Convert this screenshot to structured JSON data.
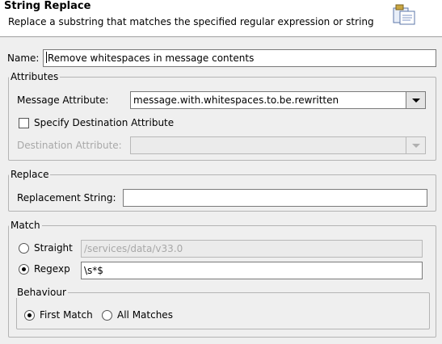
{
  "header": {
    "title": "String Replace",
    "description": "Replace a substring that matches the specified regular expression or string",
    "icon": "dialog-banner-icon"
  },
  "name": {
    "label": "Name:",
    "value": "Remove whitespaces in message contents"
  },
  "attributes": {
    "title": "Attributes",
    "message_attribute_label": "Message Attribute:",
    "message_attribute_value": "message.with.whitespaces.to.be.rewritten",
    "specify_destination_label": "Specify Destination Attribute",
    "destination_attribute_label": "Destination Attribute:",
    "destination_attribute_value": ""
  },
  "replace": {
    "title": "Replace",
    "replacement_label": "Replacement String:",
    "replacement_value": ""
  },
  "match": {
    "title": "Match",
    "straight_label": "Straight",
    "straight_value": "/services/data/v33.0",
    "regexp_label": "Regexp",
    "regexp_value": "\\s*$",
    "selected": "Regexp"
  },
  "behaviour": {
    "title": "Behaviour",
    "first_match_label": "First Match",
    "all_matches_label": "All Matches",
    "selected": "First Match"
  }
}
